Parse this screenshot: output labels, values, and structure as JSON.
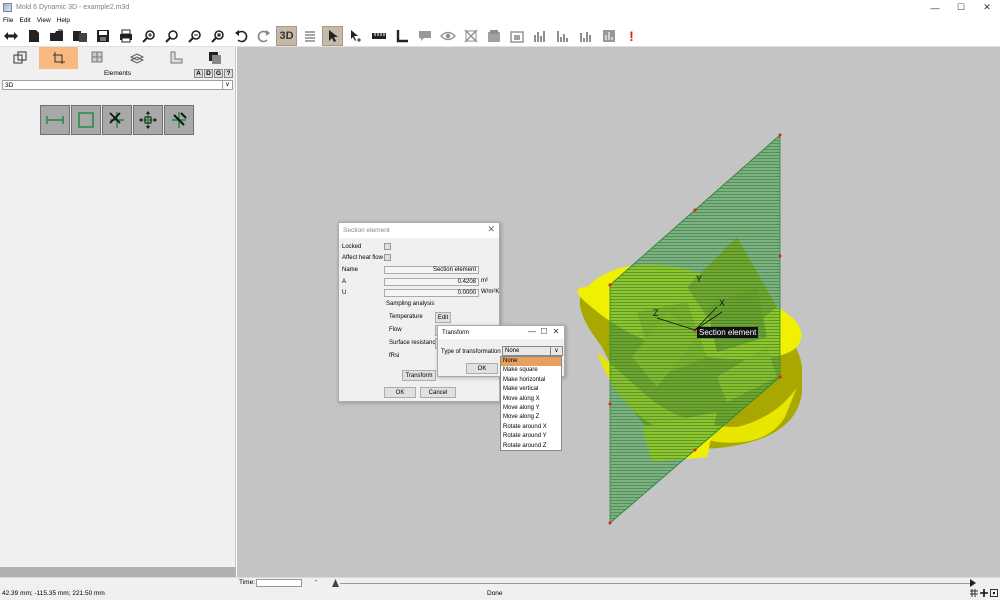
{
  "window": {
    "title": "Mold 6 Dynamic 3D - example2.m3d",
    "controls": {
      "minimize": "—",
      "maximize": "☐",
      "close": "✕"
    }
  },
  "menu": {
    "items": [
      "File",
      "Edit",
      "View",
      "Help"
    ]
  },
  "toolbar": {
    "view_3d_label": "3D",
    "alert_label": "!",
    "icons": [
      "move-arrows-icon",
      "new-file-icon",
      "open-folder-icon",
      "import-icon",
      "save-icon",
      "print-icon",
      "zoom-in-icon",
      "zoom-window-icon",
      "zoom-out-icon",
      "zoom-fit-icon",
      "undo-icon",
      "redo-icon",
      "view-3d-icon",
      "list-icon",
      "select-arrow-icon",
      "select-plus-icon",
      "ruler-icon",
      "angle-icon",
      "comment-icon",
      "eye-icon",
      "no-view-icon",
      "layer-1-icon",
      "layer-2-icon",
      "chart-1-icon",
      "chart-2-icon",
      "chart-3-icon",
      "chart-4-icon",
      "alert-icon"
    ]
  },
  "left_panel": {
    "header": "Elements",
    "letters": [
      "A",
      "D",
      "G",
      "?"
    ],
    "view_select": "3D",
    "tabs": [
      "layout-tab-icon",
      "section-tab-icon",
      "grid-tab-icon",
      "layers-tab-icon",
      "shape-tab-icon",
      "shade-tab-icon"
    ],
    "element_buttons": [
      "dimension-element-icon",
      "rectangle-element-icon",
      "cross-element-icon",
      "move-element-icon",
      "rotate-element-icon"
    ]
  },
  "canvas": {
    "section_label": "Section element",
    "axis_labels": {
      "x": "X",
      "y": "Y",
      "z": "Z"
    },
    "colors": {
      "background": "#c4c4c4",
      "model": "#f0f000",
      "model_shadow": "#a8a800",
      "plane": "#3aa04a"
    }
  },
  "section_dialog": {
    "title": "Section element",
    "close": "✕",
    "locked_label": "Locked",
    "affect_heat_flow_label": "Affect heat flow",
    "name_label": "Name",
    "name_value": "Section element",
    "a_label": "A",
    "a_value": "0.4208",
    "a_unit": "m²",
    "u_label": "U",
    "u_value": "0.0000",
    "u_unit": "W/m²K",
    "sampling_label": "Sampling analysis",
    "temperature_label": "Temperature",
    "flow_label": "Flow",
    "surface_resistance_label": "Surface resistance",
    "frsi_label": "fRsi",
    "edit_button": "Edit",
    "transform_button": "Transform",
    "ok_button": "OK",
    "cancel_button": "Cancel"
  },
  "transform_dialog": {
    "title": "Transform",
    "minimize": "—",
    "maximize": "☐",
    "close": "✕",
    "type_label": "Type of transformation",
    "type_value": "None",
    "ok_button": "OK",
    "options": [
      "None",
      "Make square",
      "Make horizontal",
      "Make vertical",
      "Move along X",
      "Move along Y",
      "Move along Z",
      "Rotate around X",
      "Rotate around Y",
      "Rotate around Z"
    ],
    "selected_index": 0
  },
  "timebar": {
    "time_label": "Time:",
    "time_value": "",
    "dash": "-"
  },
  "statusbar": {
    "coordinates": "42.39 mm; -115.35 mm; 221.50 mm",
    "status": "Done"
  }
}
